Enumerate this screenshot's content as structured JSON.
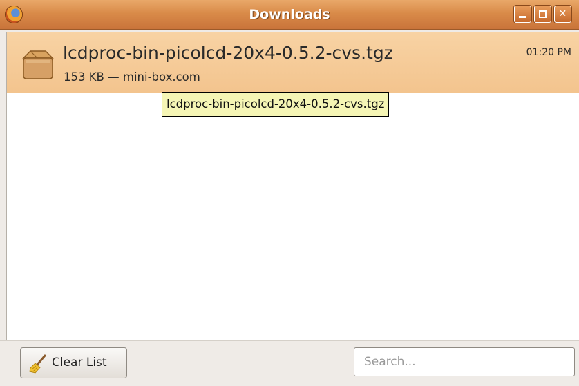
{
  "window": {
    "title": "Downloads",
    "controls": {
      "minimize": "minimize",
      "maximize": "maximize",
      "close": "✕"
    }
  },
  "downloads": [
    {
      "filename": "lcdproc-bin-picolcd-20x4-0.5.2-cvs.tgz",
      "meta": "153 KB — mini-box.com",
      "time": "01:20 PM",
      "icon": "package-icon"
    }
  ],
  "tooltip": {
    "text": "lcdproc-bin-picolcd-20x4-0.5.2-cvs.tgz"
  },
  "toolbar": {
    "clear_accel": "C",
    "clear_rest": "lear List",
    "clear_icon": "broom-icon",
    "search_placeholder": "Search..."
  },
  "colors": {
    "titlebar": "#d98b49",
    "selected_row": "#f5c996",
    "tooltip_bg": "#f5f5b5"
  }
}
